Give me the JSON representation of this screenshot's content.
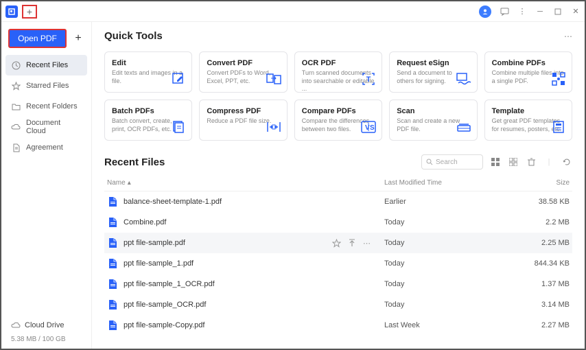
{
  "titlebar": {
    "new_tab": "+"
  },
  "sidebar": {
    "open_label": "Open PDF",
    "items": [
      {
        "icon": "clock",
        "label": "Recent Files",
        "active": true
      },
      {
        "icon": "star",
        "label": "Starred Files",
        "active": false
      },
      {
        "icon": "folder",
        "label": "Recent Folders",
        "active": false
      },
      {
        "icon": "cloud",
        "label": "Document Cloud",
        "active": false
      },
      {
        "icon": "doc",
        "label": "Agreement",
        "active": false
      }
    ],
    "cloud_drive": "Cloud Drive",
    "storage": "5.38 MB / 100 GB"
  },
  "quick_tools": {
    "title": "Quick Tools",
    "tools": [
      {
        "title": "Edit",
        "desc": "Edit texts and images in a file.",
        "icon": "edit"
      },
      {
        "title": "Convert PDF",
        "desc": "Convert PDFs to Word, Excel, PPT, etc.",
        "icon": "convert"
      },
      {
        "title": "OCR PDF",
        "desc": "Turn scanned documents into searchable or editable ...",
        "icon": "ocr"
      },
      {
        "title": "Request eSign",
        "desc": "Send a document to others for signing.",
        "icon": "esign"
      },
      {
        "title": "Combine PDFs",
        "desc": "Combine multiple files into a single PDF.",
        "icon": "combine"
      },
      {
        "title": "Batch PDFs",
        "desc": "Batch convert, create, print, OCR PDFs, etc.",
        "icon": "batch"
      },
      {
        "title": "Compress PDF",
        "desc": "Reduce a PDF file size.",
        "icon": "compress"
      },
      {
        "title": "Compare PDFs",
        "desc": "Compare the differences between two files.",
        "icon": "compare"
      },
      {
        "title": "Scan",
        "desc": "Scan and create a new PDF file.",
        "icon": "scan"
      },
      {
        "title": "Template",
        "desc": "Get great PDF templates for resumes, posters, etc.",
        "icon": "template"
      }
    ]
  },
  "recent": {
    "title": "Recent Files",
    "search_placeholder": "Search",
    "columns": {
      "name": "Name",
      "modified": "Last Modified Time",
      "size": "Size"
    },
    "files": [
      {
        "name": "balance-sheet-template-1.pdf",
        "modified": "Earlier",
        "size": "38.58 KB"
      },
      {
        "name": "Combine.pdf",
        "modified": "Today",
        "size": "2.2 MB"
      },
      {
        "name": "ppt file-sample.pdf",
        "modified": "Today",
        "size": "2.25 MB",
        "hover": true
      },
      {
        "name": "ppt file-sample_1.pdf",
        "modified": "Today",
        "size": "844.34 KB"
      },
      {
        "name": "ppt file-sample_1_OCR.pdf",
        "modified": "Today",
        "size": "1.37 MB"
      },
      {
        "name": "ppt file-sample_OCR.pdf",
        "modified": "Today",
        "size": "3.14 MB"
      },
      {
        "name": "ppt file-sample-Copy.pdf",
        "modified": "Last Week",
        "size": "2.27 MB"
      }
    ]
  }
}
